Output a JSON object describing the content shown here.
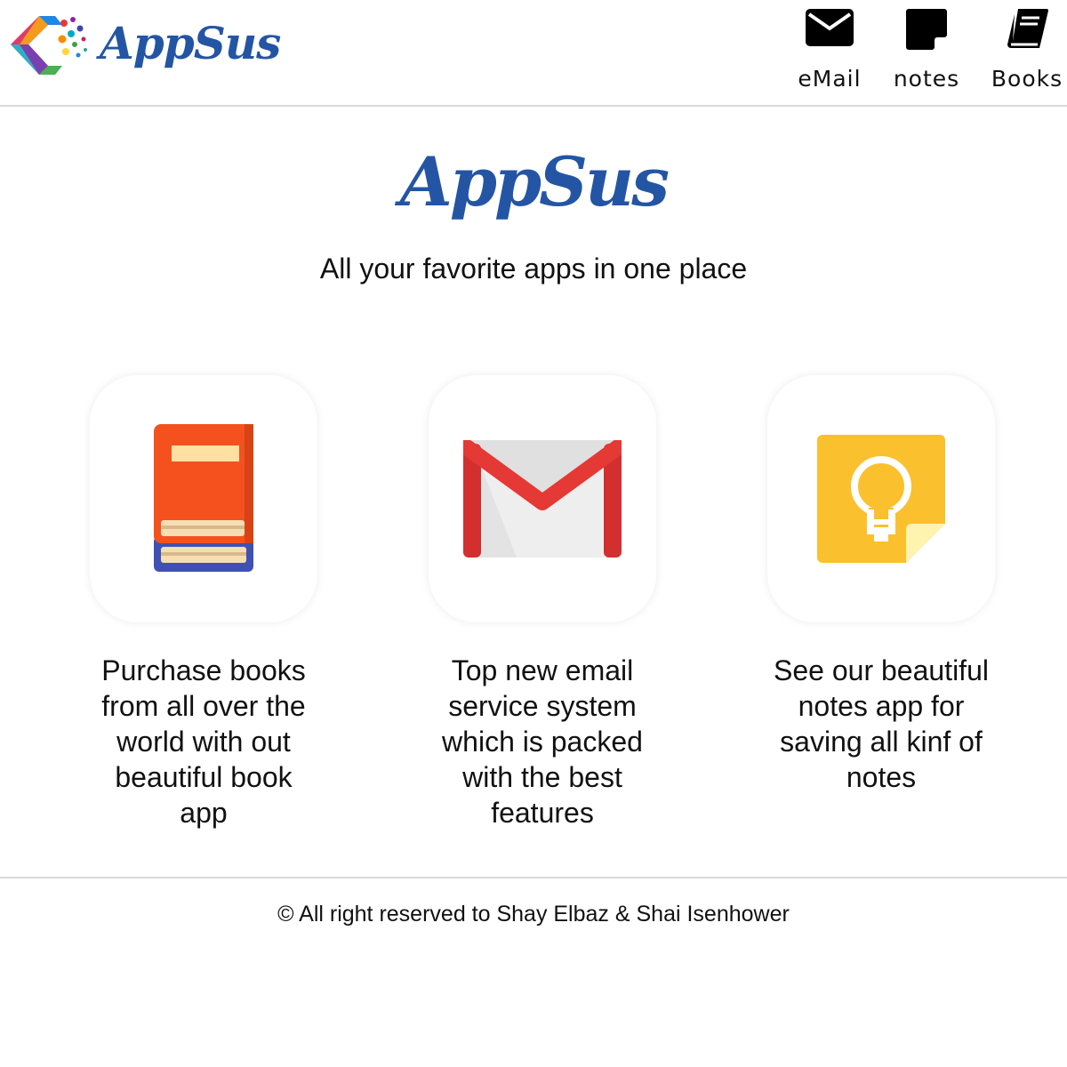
{
  "header": {
    "brand_name": "AppSus",
    "nav": [
      {
        "label": "eMail",
        "icon": "envelope-icon"
      },
      {
        "label": "notes",
        "icon": "sticky-note-icon"
      },
      {
        "label": "Books",
        "icon": "book-icon"
      }
    ]
  },
  "hero": {
    "title": "AppSus",
    "tagline": "All your favorite apps in one place"
  },
  "features": [
    {
      "icon": "book-app-icon",
      "text": "Purchase books from all over the world with out beautiful book app"
    },
    {
      "icon": "gmail-app-icon",
      "text": "Top new email service system which is packed with the best features"
    },
    {
      "icon": "keep-notes-app-icon",
      "text": "See our beautiful notes app for saving all kinf of notes"
    }
  ],
  "footer": {
    "text": "© All right reserved to Shay Elbaz & Shai Isenhower"
  },
  "colors": {
    "brand_blue": "#2455a4",
    "divider": "#d9d9d9"
  }
}
